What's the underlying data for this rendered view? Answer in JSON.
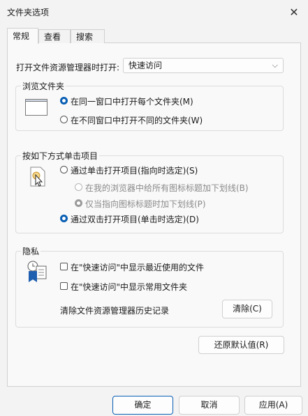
{
  "window": {
    "title": "文件夹选项",
    "close_glyph": "✕"
  },
  "tabs": [
    {
      "label": "常规",
      "active": true
    },
    {
      "label": "查看",
      "active": false
    },
    {
      "label": "搜索",
      "active": false
    }
  ],
  "open_explorer": {
    "label": "打开文件资源管理器时打开:",
    "value": "快速访问",
    "chevron": "⌵"
  },
  "browse_folders": {
    "title": "浏览文件夹",
    "options": [
      {
        "label": "在同一窗口中打开每个文件夹(M)",
        "selected": true
      },
      {
        "label": "在不同窗口中打开不同的文件夹(W)",
        "selected": false
      }
    ]
  },
  "click_items": {
    "title": "按如下方式单击项目",
    "single": {
      "label": "通过单击打开项目(指向时选定)(S)",
      "selected": false
    },
    "underline_all": {
      "label": "在我的浏览器中给所有图标标题加下划线(B)",
      "selected": false,
      "disabled": true
    },
    "underline_hover": {
      "label": "仅当指向图标标题时加下划线(P)",
      "selected": true,
      "disabled": true
    },
    "double": {
      "label": "通过双击打开项目(单击时选定)(D)",
      "selected": true
    }
  },
  "privacy": {
    "title": "隐私",
    "show_recent": {
      "label": "在\"快速访问\"中显示最近使用的文件",
      "checked": false
    },
    "show_frequent": {
      "label": "在\"快速访问\"中显示常用文件夹",
      "checked": false
    },
    "clear_history_label": "清除文件资源管理器历史记录",
    "clear_button": "清除(C)"
  },
  "restore_defaults_button": "还原默认值(R)",
  "footer": {
    "ok": "确定",
    "cancel": "取消",
    "apply": "应用(A)"
  },
  "colors": {
    "accent": "#0a5fb4",
    "window_bg": "#f3f3f3",
    "panel_bg": "#f9f9f9"
  }
}
